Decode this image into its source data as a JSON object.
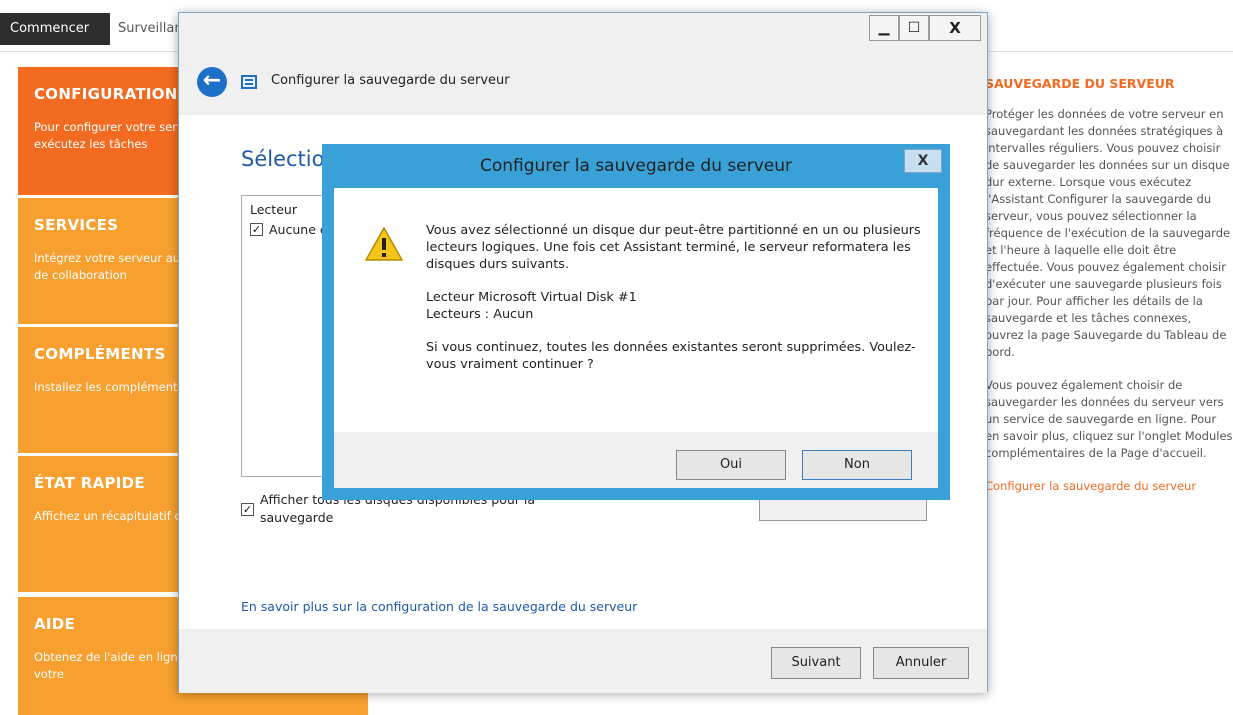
{
  "topbar": {
    "tab_active": "Commencer",
    "tab_next": "Surveillance"
  },
  "panels": [
    {
      "title": "CONFIGURATION",
      "desc": "Pour configurer votre serveur pour la première fois, exécutez les tâches"
    },
    {
      "title": "SERVICES",
      "desc": "Intégrez votre serveur aux services de productivité et de collaboration"
    },
    {
      "title": "COMPLÉMENTS",
      "desc": "Installez les compléments pour votre entreprise."
    },
    {
      "title": "ÉTAT RAPIDE",
      "desc": "Affichez un récapitulatif de la configuration du serveur"
    },
    {
      "title": "AIDE",
      "desc": "Obtenez de l'aide en ligne et des informations sur votre"
    }
  ],
  "right_column": {
    "title": "SAUVEGARDE DU SERVEUR",
    "para1": "Protéger les données de votre serveur en sauvegardant les données stratégiques à intervalles réguliers. Vous pouvez choisir de sauvegarder les données sur un disque dur externe. Lorsque vous exécutez l'Assistant Configurer la sauvegarde du serveur, vous pouvez sélectionner la fréquence de l'exécution de la sauvegarde et l'heure à laquelle elle doit être effectuée. Vous pouvez également choisir d'exécuter une sauvegarde plusieurs fois par jour. Pour afficher les détails de la sauvegarde et les tâches connexes, ouvrez la page Sauvegarde du Tableau de bord.",
    "para2": "Vous pouvez également choisir de sauvegarder les données du serveur vers un service de sauvegarde en ligne. Pour en savoir plus, cliquez sur l'onglet Modules complémentaires de la Page d'accueil.",
    "link": "Configurer la sauvegarde du serveur"
  },
  "wizard": {
    "window_buttons": {
      "minimize": "▁",
      "maximize": "☐",
      "close": "X"
    },
    "title": "Configurer la sauvegarde du serveur",
    "section_title": "Sélectionner la destination de sauvegarde",
    "list_header": "Lecteur",
    "list_row": "Aucune élément",
    "show_all_line1": "Afficher tous les disques disponibles pour la",
    "show_all_line2": "sauvegarde",
    "learn_link": "En savoir plus sur la configuration de la sauvegarde du serveur",
    "next_label": "Suivant",
    "cancel_label": "Annuler"
  },
  "dialog": {
    "title": "Configurer la sauvegarde du serveur",
    "close_label": "X",
    "message1": "Vous avez sélectionné un disque dur peut-être partitionné en un ou plusieurs lecteurs logiques. Une fois cet Assistant terminé, le serveur reformatera les disques durs suivants.",
    "disk_line1": "Lecteur Microsoft Virtual Disk #1",
    "disk_line2": "Lecteurs : Aucun",
    "message2": "Si vous continuez, toutes les données existantes seront supprimées. Voulez-vous vraiment continuer ?",
    "yes_label": "Oui",
    "no_label": "Non"
  },
  "colors": {
    "accent_orange": "#f26b21",
    "panel_orange": "#f7a030",
    "dialog_blue": "#3aa0d8",
    "link_blue": "#1e5aa8"
  }
}
